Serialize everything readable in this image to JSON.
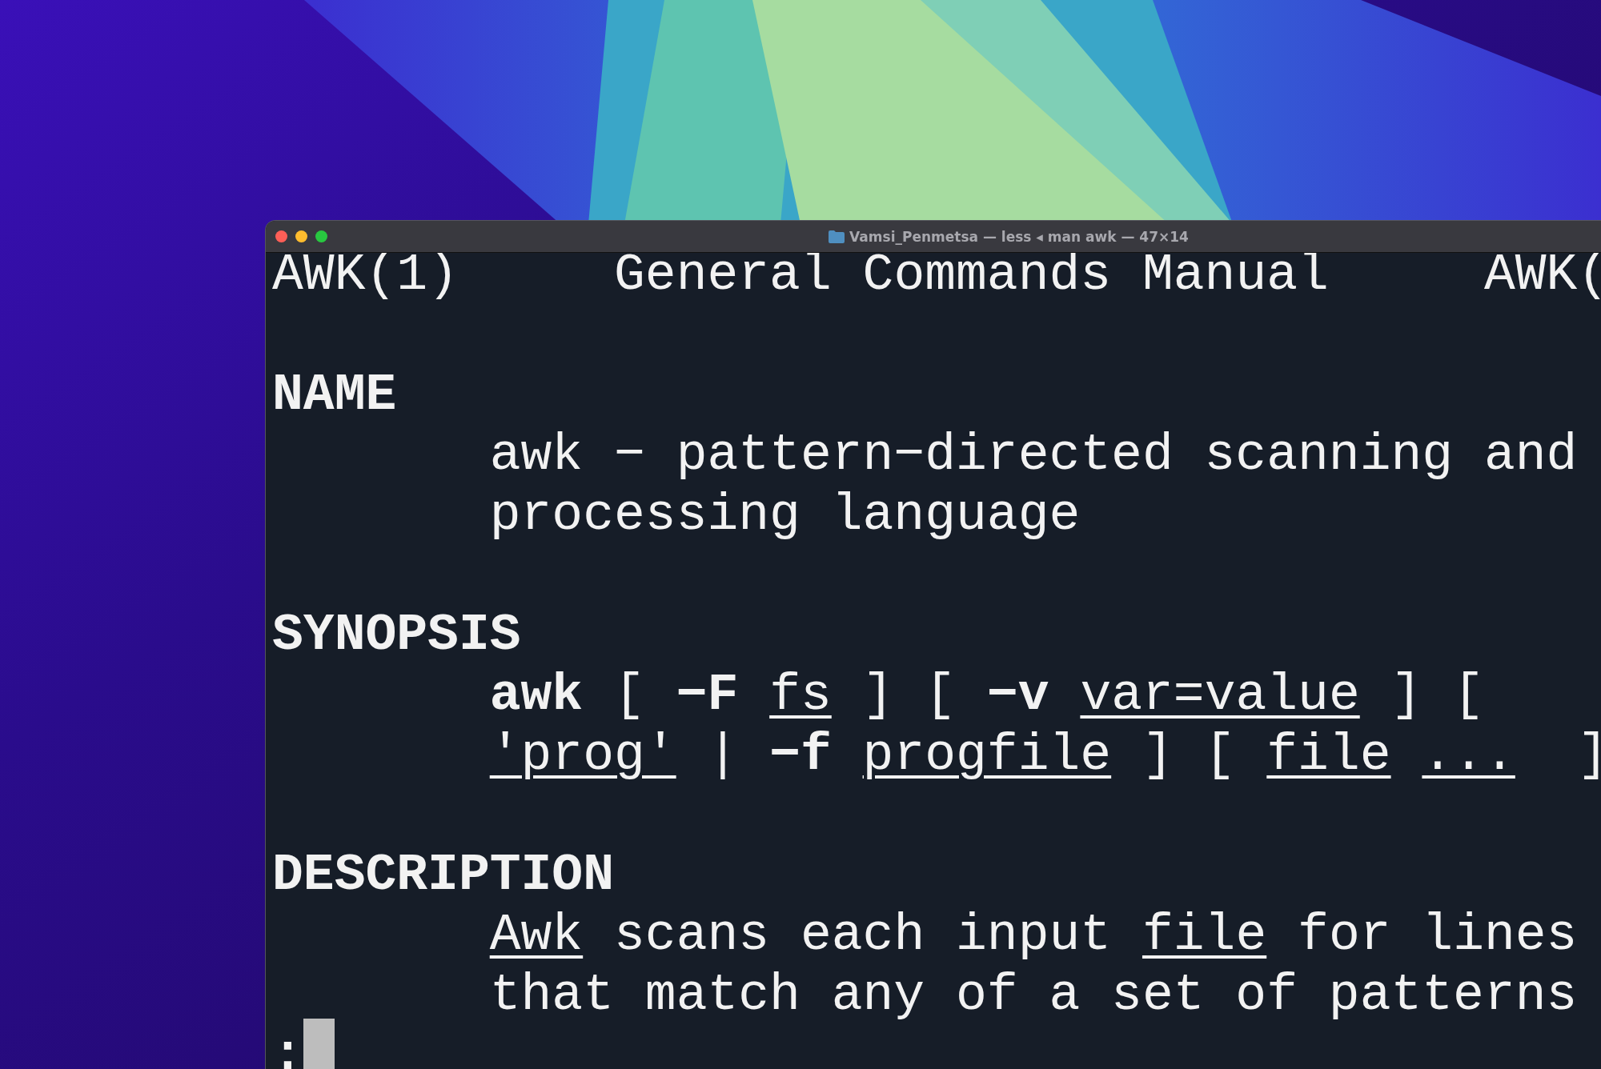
{
  "window": {
    "title": "Vamsi_Penmetsa — less ◂ man awk — 47×14"
  },
  "man_page": {
    "header": {
      "left": "AWK(1)",
      "center": "General Commands Manual",
      "right": "AWK("
    },
    "sections": [
      {
        "title": "NAME",
        "lines": [
          [
            {
              "text": "awk − pattern−directed scanning and",
              "kind": "plain"
            }
          ],
          [
            {
              "text": "processing language",
              "kind": "plain"
            }
          ]
        ]
      },
      {
        "title": "SYNOPSIS",
        "lines": [
          [
            {
              "text": "awk",
              "kind": "bold"
            },
            {
              "text": "[",
              "kind": "plain"
            },
            {
              "text": "−F",
              "kind": "bold"
            },
            {
              "text": "fs",
              "kind": "underline"
            },
            {
              "text": "] [",
              "kind": "plain"
            },
            {
              "text": "−v",
              "kind": "bold"
            },
            {
              "text": "var=value",
              "kind": "underline"
            },
            {
              "text": "] [",
              "kind": "plain"
            }
          ],
          [
            {
              "text": "'prog'",
              "kind": "underline"
            },
            {
              "text": "|",
              "kind": "plain"
            },
            {
              "text": "−f",
              "kind": "bold"
            },
            {
              "text": "progfile",
              "kind": "underline"
            },
            {
              "text": "] [",
              "kind": "plain"
            },
            {
              "text": "file",
              "kind": "underline"
            },
            {
              "text": "...",
              "kind": "underline"
            },
            {
              "text": " ]",
              "kind": "plain"
            }
          ]
        ]
      },
      {
        "title": "DESCRIPTION",
        "lines": [
          [
            {
              "text": "Awk",
              "kind": "underline"
            },
            {
              "text": "scans each input",
              "kind": "plain"
            },
            {
              "text": "file",
              "kind": "underline"
            },
            {
              "text": "for lines",
              "kind": "plain"
            }
          ],
          [
            {
              "text": "that match any of a set of patterns",
              "kind": "plain"
            }
          ]
        ]
      }
    ],
    "prompt": ":"
  }
}
